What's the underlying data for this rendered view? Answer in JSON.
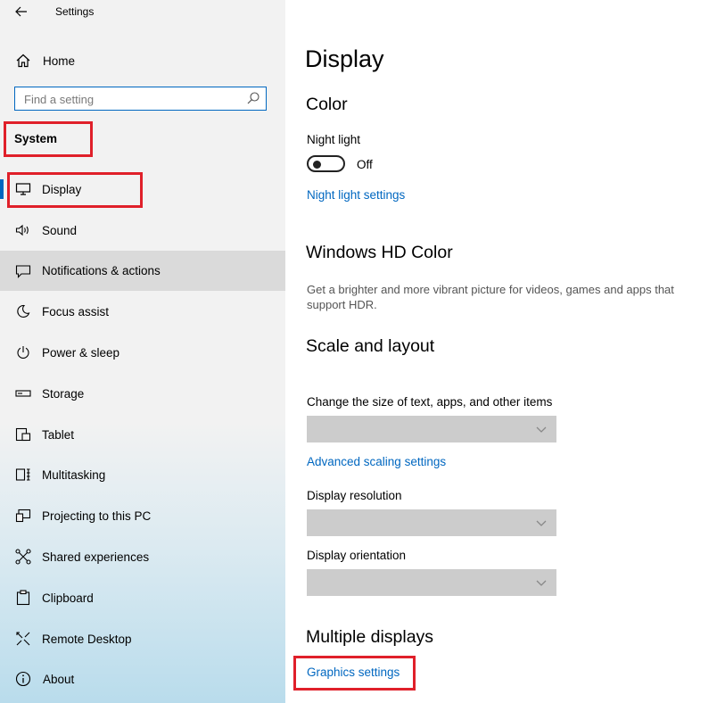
{
  "window": {
    "title": "Settings"
  },
  "sidebar": {
    "home_label": "Home",
    "search_placeholder": "Find a setting",
    "section": "System",
    "items": [
      {
        "label": "Display",
        "icon": "monitor-icon"
      },
      {
        "label": "Sound",
        "icon": "speaker-icon"
      },
      {
        "label": "Notifications & actions",
        "icon": "notification-icon"
      },
      {
        "label": "Focus assist",
        "icon": "moon-icon"
      },
      {
        "label": "Power & sleep",
        "icon": "power-icon"
      },
      {
        "label": "Storage",
        "icon": "storage-icon"
      },
      {
        "label": "Tablet",
        "icon": "tablet-icon"
      },
      {
        "label": "Multitasking",
        "icon": "multitasking-icon"
      },
      {
        "label": "Projecting to this PC",
        "icon": "projector-icon"
      },
      {
        "label": "Shared experiences",
        "icon": "share-icon"
      },
      {
        "label": "Clipboard",
        "icon": "clipboard-icon"
      },
      {
        "label": "Remote Desktop",
        "icon": "remote-desktop-icon"
      },
      {
        "label": "About",
        "icon": "info-icon"
      }
    ]
  },
  "main": {
    "title": "Display",
    "color": {
      "heading": "Color",
      "night_light_label": "Night light",
      "night_light_state": "Off",
      "night_light_settings_link": "Night light settings"
    },
    "hd_color": {
      "heading": "Windows HD Color",
      "description": "Get a brighter and more vibrant picture for videos, games and apps that support HDR."
    },
    "scale": {
      "heading": "Scale and layout",
      "size_label": "Change the size of text, apps, and other items",
      "advanced_link": "Advanced scaling settings",
      "resolution_label": "Display resolution",
      "orientation_label": "Display orientation"
    },
    "multiple": {
      "heading": "Multiple displays",
      "graphics_link": "Graphics settings"
    }
  },
  "colors": {
    "accent": "#0067c0",
    "highlight_box": "#e0202a",
    "hover_row": "#dadada",
    "dropdown_bg": "#cccccc"
  }
}
